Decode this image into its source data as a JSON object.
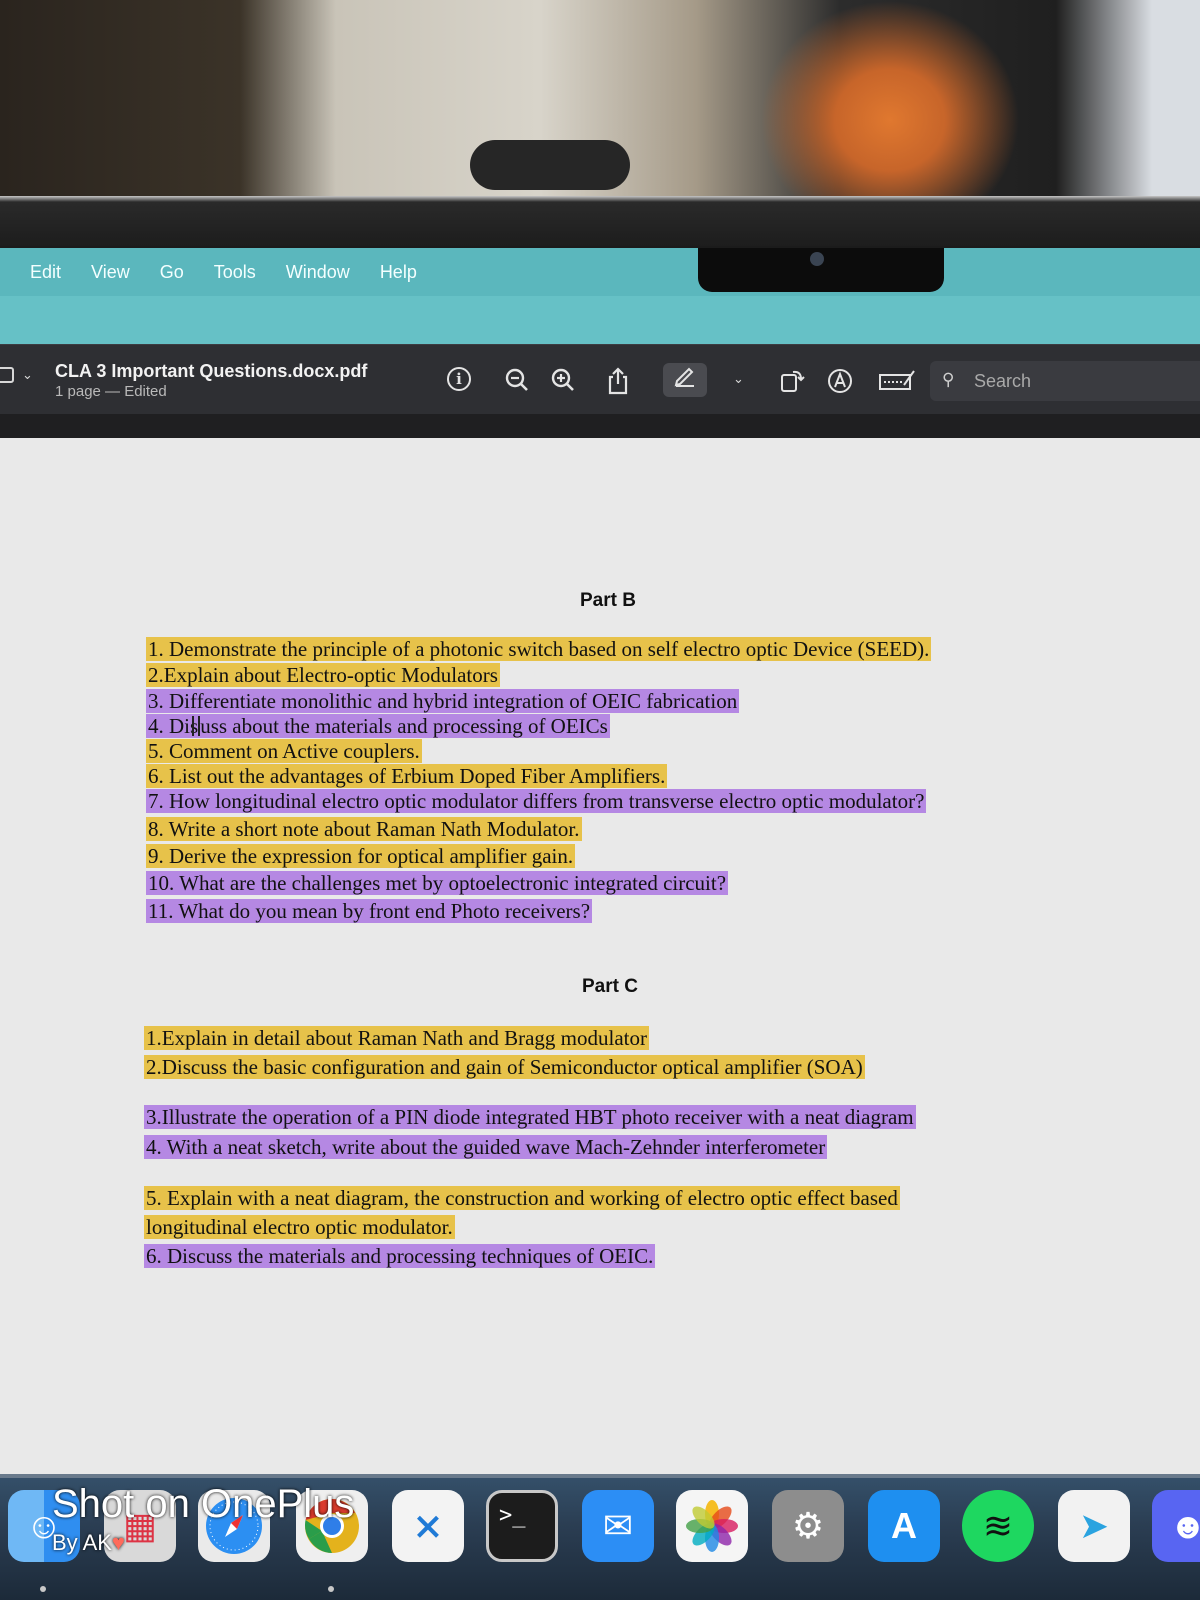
{
  "menubar": {
    "items": [
      "Edit",
      "View",
      "Go",
      "Tools",
      "Window",
      "Help"
    ]
  },
  "toolbar": {
    "title": "CLA 3 Important Questions.docx.pdf",
    "subtitle": "1 page — Edited",
    "search_placeholder": "Search"
  },
  "document": {
    "part_b": {
      "heading": "Part B",
      "questions": [
        {
          "text": "1. Demonstrate  the principle of a photonic switch based on self electro optic Device (SEED).",
          "highlight": "yellow"
        },
        {
          "text": "2.Explain about Electro-optic Modulators",
          "highlight": "yellow"
        },
        {
          "text": "3. Differentiate monolithic and hybrid integration of OEIC fabrication",
          "highlight": "purple"
        },
        {
          "text_before": "4. Dis",
          "text_after": "uss about the materials and processing of OEICs",
          "highlight": "purple"
        },
        {
          "text": "5. Comment on Active couplers.",
          "highlight": "yellow"
        },
        {
          "text": "6. List out the advantages of Erbium Doped Fiber Amplifiers.",
          "highlight": "yellow"
        },
        {
          "text": "7. How longitudinal electro optic modulator differs from transverse electro optic modulator?",
          "highlight": "purple"
        },
        {
          "text": "8. Write a short note about Raman Nath Modulator.",
          "highlight": "yellow"
        },
        {
          "text": "9. Derive the expression for optical amplifier gain.",
          "highlight": "yellow"
        },
        {
          "text": "10. What are the challenges met by optoelectronic integrated circuit?",
          "highlight": "purple"
        },
        {
          "text": "11. What do you mean by front end Photo receivers?",
          "highlight": "purple"
        }
      ]
    },
    "part_c": {
      "heading": "Part C",
      "questions": [
        {
          "text": "1.Explain in detail about Raman Nath and Bragg modulator",
          "highlight": "yellow"
        },
        {
          "text": "2.Discuss the basic configuration and gain of Semiconductor optical amplifier (SOA)",
          "highlight": "yellow"
        },
        {
          "text": "3.Illustrate the operation of a PIN diode integrated HBT photo receiver with a neat diagram",
          "highlight": "purple"
        },
        {
          "text": "4. With a neat sketch, write about the guided wave Mach-Zehnder interferometer",
          "highlight": "purple"
        },
        {
          "text": "5. Explain with a neat diagram, the construction and working of electro optic effect based",
          "highlight": "yellow"
        },
        {
          "text": "longitudinal electro optic modulator.",
          "highlight": "yellow"
        },
        {
          "text": "6. Discuss the materials and processing techniques of OEIC.",
          "highlight": "purple"
        }
      ]
    }
  },
  "watermark": {
    "line1": "Shot on OnePlus",
    "line2": "By AK"
  },
  "colors": {
    "highlight_yellow": "#e7c24a",
    "highlight_purple": "#b588e3",
    "menubar": "#5bb7bd",
    "toolbar": "#2e2f33"
  }
}
